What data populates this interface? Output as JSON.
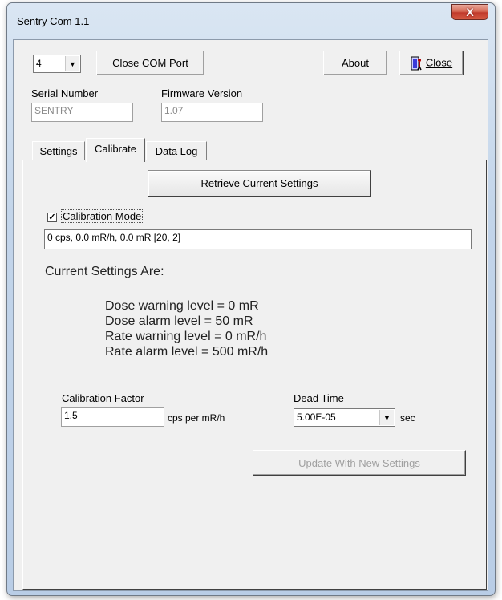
{
  "window": {
    "title": "Sentry Com 1.1",
    "close_glyph": "X"
  },
  "com_port": {
    "selected": "4",
    "close_button_label": "Close COM Port"
  },
  "toolbar": {
    "about_label": "About",
    "close_label": "Close",
    "close_icon": "exit-door-icon"
  },
  "device": {
    "serial_number_label": "Serial Number",
    "serial_number_value": "SENTRY",
    "firmware_version_label": "Firmware Version",
    "firmware_version_value": "1.07"
  },
  "tabs": [
    {
      "label": "Settings",
      "active": false
    },
    {
      "label": "Calibrate",
      "active": true
    },
    {
      "label": "Data Log",
      "active": false
    }
  ],
  "calibrate": {
    "retrieve_button_label": "Retrieve Current Settings",
    "calibration_mode_label": "Calibration Mode",
    "calibration_mode_checked": true,
    "status_readout": "0 cps, 0.0 mR/h, 0.0 mR  [20, 2]",
    "current_settings_heading": "Current Settings Are:",
    "settings_lines": [
      "Dose warning level = 0 mR",
      "Dose alarm level = 50 mR",
      "Rate warning level = 0 mR/h",
      "Rate alarm level = 500 mR/h"
    ],
    "calibration_factor_label": "Calibration Factor",
    "calibration_factor_value": "1.5",
    "calibration_factor_unit": "cps per mR/h",
    "dead_time_label": "Dead Time",
    "dead_time_value": "5.00E-05",
    "dead_time_unit": "sec",
    "update_button_label": "Update With New Settings"
  },
  "colors": {
    "window_frame": "#c3d5ea",
    "close_button": "#c0392b",
    "client_background": "#f0f0f0"
  }
}
